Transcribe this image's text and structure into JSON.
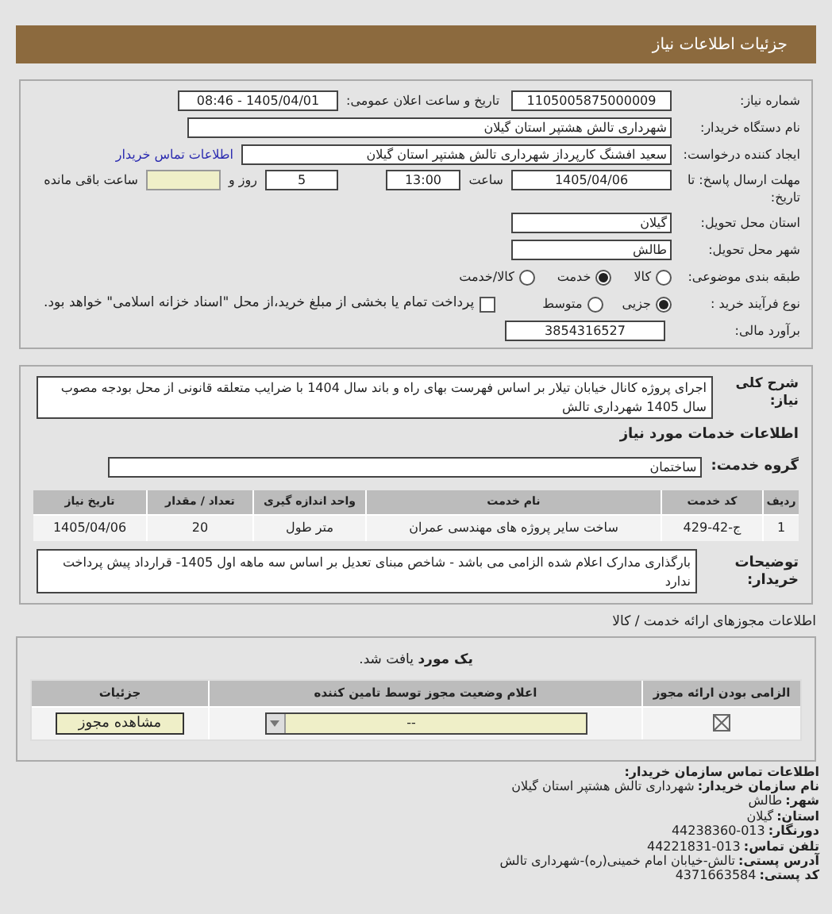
{
  "header": {
    "title": "جزئیات اطلاعات نیاز"
  },
  "need_details": {
    "need_number": {
      "label": "شماره نیاز:",
      "value": "1105005875000009"
    },
    "announce_datetime": {
      "label": "تاریخ و ساعت اعلان عمومی:",
      "value": "1405/04/01 - 08:46"
    },
    "buyer_org": {
      "label": "نام دستگاه خریدار:",
      "value": "شهرداری تالش هشتپر استان گیلان"
    },
    "requester": {
      "label": "ایجاد کننده درخواست:",
      "value": "سعید افشنگ کارپرداز شهرداری تالش هشتپر استان گیلان",
      "link": "اطلاعات تماس خریدار"
    },
    "deadline": {
      "label": "مهلت ارسال پاسخ: تا تاریخ:",
      "date": "1405/04/06",
      "time_label": "ساعت",
      "time": "13:00",
      "days": "5",
      "days_label": "روز و",
      "remaining_label": "ساعت باقی مانده"
    },
    "province": {
      "label": "استان محل تحویل:",
      "value": "گیلان"
    },
    "city": {
      "label": "شهر محل تحویل:",
      "value": "طالش"
    },
    "category": {
      "label": "طبقه بندی موضوعی:",
      "options": [
        {
          "label": "کالا",
          "selected": false
        },
        {
          "label": "خدمت",
          "selected": true
        },
        {
          "label": "کالا/خدمت",
          "selected": false
        }
      ]
    },
    "process": {
      "label": "نوع فرآیند خرید :",
      "options": [
        {
          "label": "جزیی",
          "selected": true
        },
        {
          "label": "متوسط",
          "selected": false
        }
      ],
      "payment": {
        "checked": false,
        "label": "پرداخت تمام یا بخشی از مبلغ خرید،از محل \"اسناد خزانه اسلامی\" خواهد بود."
      }
    },
    "budget": {
      "label": "برآورد مالی:",
      "value": "3854316527"
    }
  },
  "services": {
    "description": {
      "label": "شرح کلی نیاز:",
      "value": "اجرای پروژه کانال خیابان تیلار بر اساس فهرست بهای راه و باند سال 1404 با ضرایب متعلقه قانونی از محل بودجه مصوب سال 1405 شهرداری تالش"
    },
    "heading": "اطلاعات خدمات مورد نیاز",
    "group": {
      "label": "گروه خدمت:",
      "value": "ساختمان"
    },
    "table": {
      "columns": [
        "ردیف",
        "کد خدمت",
        "نام خدمت",
        "واحد اندازه گیری",
        "تعداد / مقدار",
        "تاریخ نیاز"
      ],
      "rows": [
        [
          "1",
          "ج-42-429",
          "ساخت سایر پروژه های مهندسی عمران",
          "متر طول",
          "20",
          "1405/04/06"
        ]
      ]
    },
    "buyer_notes": {
      "label": "توضیحات خریدار:",
      "value": "بارگذاری مدارک اعلام شده الزامی می باشد - شاخص مبنای تعدیل بر اساس سه ماهه اول 1405- قرارداد پیش پرداخت ندارد"
    }
  },
  "permits": {
    "heading": "اطلاعات مجوزهای ارائه خدمت / کالا",
    "found": "**یک مورد** یافت شد.",
    "columns": [
      "الزامی بودن ارائه مجوز",
      "اعلام وضعیت مجوز توسط تامین کننده",
      "جزئیات"
    ],
    "rows": [
      {
        "required": true,
        "status": "--",
        "button": "مشاهده مجوز"
      }
    ]
  },
  "contact": {
    "title": "اطلاعات تماس سازمان خریدار:",
    "items": [
      {
        "label": "نام سازمان خریدار:",
        "value": "شهرداری تالش هشتپر استان گیلان"
      },
      {
        "label": "شهر:",
        "value": "طالش"
      },
      {
        "label": "استان:",
        "value": "گیلان"
      },
      {
        "label": "دورنگار:",
        "value": "013-44238360"
      },
      {
        "label": "تلفن تماس:",
        "value": "013-44221831"
      },
      {
        "label": "آدرس پستی:",
        "value": "تالش-خیابان امام خمینی(ره)-شهرداری تالش"
      },
      {
        "label": "کد پستی:",
        "value": "4371663584"
      }
    ]
  }
}
